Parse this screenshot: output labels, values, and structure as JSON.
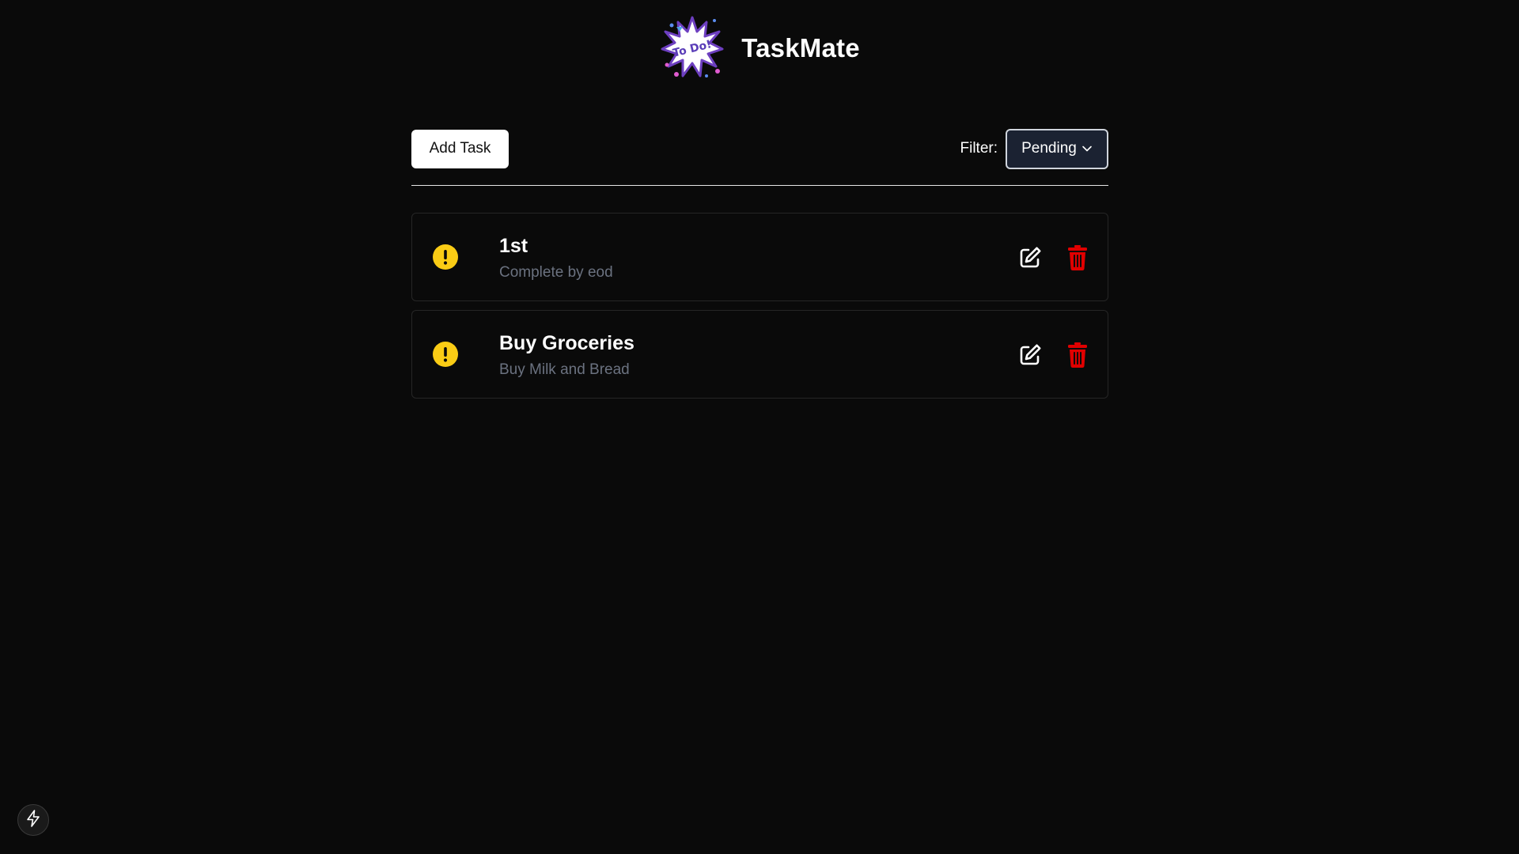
{
  "header": {
    "app_title": "TaskMate",
    "logo_text": "To Do!"
  },
  "toolbar": {
    "add_label": "Add Task",
    "filter_label": "Filter:",
    "filter_value": "Pending"
  },
  "tasks": [
    {
      "title": "1st",
      "description": "Complete by eod",
      "status": "pending",
      "status_icon": "exclamation-circle-icon"
    },
    {
      "title": "Buy Groceries",
      "description": "Buy Milk and Bread",
      "status": "pending",
      "status_icon": "exclamation-circle-icon"
    }
  ],
  "colors": {
    "background": "#0a0a0a",
    "pending": "#facc15",
    "delete": "#e10000",
    "muted_text": "#6b7280",
    "filter_bg": "#1b2232"
  },
  "icons": {
    "edit": "edit-icon",
    "delete": "trash-icon",
    "bottom_left": "bolt-icon"
  }
}
